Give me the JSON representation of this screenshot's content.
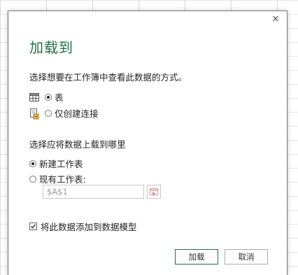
{
  "dialog": {
    "title": "加载到",
    "close_glyph": "×",
    "prompt_view": "选择想要在工作簿中查看此数据的方式。",
    "view_options": [
      {
        "label": "表",
        "icon": "table-icon",
        "selected": true
      },
      {
        "label": "仅创建连接",
        "icon": "connection-icon",
        "selected": false
      }
    ],
    "prompt_location": "选择应将数据上载到哪里",
    "location_options": [
      {
        "label": "新建工作表",
        "selected": true
      },
      {
        "label": "现有工作表:",
        "selected": false
      }
    ],
    "cell_reference": "$A$1",
    "data_model_checkbox": {
      "label": "将此数据添加到数据模型",
      "checked": true
    },
    "load_button": "加载",
    "cancel_button": "取消"
  },
  "colors": {
    "accent": "#217346",
    "title": "#217346"
  }
}
